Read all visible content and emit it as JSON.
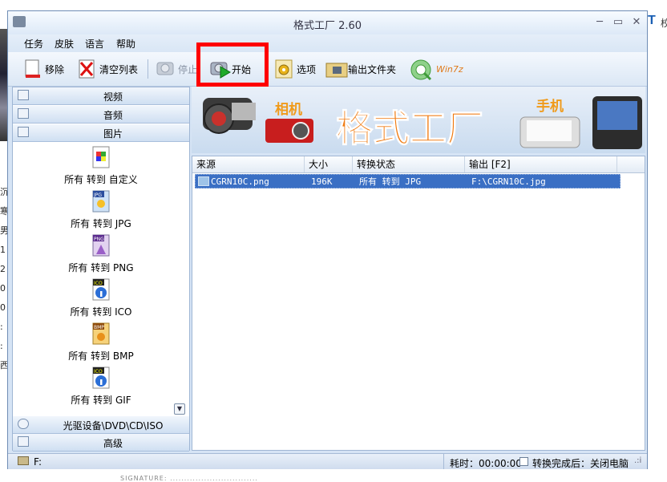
{
  "window": {
    "title": "格式工厂 2.60"
  },
  "window_controls": {
    "minimize": "─",
    "maximize": "▭",
    "close": "✕"
  },
  "menu": [
    "任务",
    "皮肤",
    "语言",
    "帮助"
  ],
  "toolbar": {
    "remove": "移除",
    "clear": "清空列表",
    "stop": "停止",
    "start": "开始",
    "options": "选项",
    "output_folder": "输出文件夹",
    "win7z": "Win7z"
  },
  "sidebar": {
    "video": "视频",
    "audio": "音频",
    "image": "图片",
    "conversions": [
      {
        "label": "所有 转到 自定义",
        "badge": ""
      },
      {
        "label": "所有 转到 JPG",
        "badge": "JPG"
      },
      {
        "label": "所有 转到 PNG",
        "badge": "PNG"
      },
      {
        "label": "所有 转到 ICO",
        "badge": "ICO"
      },
      {
        "label": "所有 转到 BMP",
        "badge": "BMP"
      },
      {
        "label": "所有 转到 GIF",
        "badge": "ICO"
      }
    ],
    "optical": "光驱设备\\DVD\\CD\\ISO",
    "advanced": "高级"
  },
  "banner": {
    "camera": "相机",
    "title": "格式工厂",
    "phone": "手机"
  },
  "list": {
    "headers": [
      "来源",
      "大小",
      "转换状态",
      "输出 [F2]"
    ],
    "rows": [
      {
        "source": "CGRN10C.png",
        "size": "196K",
        "status": "所有 转到 JPG",
        "output": "F:\\CGRN10C.jpg"
      }
    ]
  },
  "status": {
    "drive": "F:",
    "elapsed": "耗时：00:00:00",
    "after_label": "转换完成后：关闭电脑",
    "grip": ".:i"
  },
  "background": {
    "left_chars": [
      "沉",
      "寒",
      "男",
      "1",
      "2",
      "0",
      "0",
      ":",
      ":",
      "西"
    ],
    "right_t": "T",
    "right_c": "校",
    "signature": "SIGNATURE: ..............................."
  },
  "colors": {
    "accent": "#3a6fc4",
    "highlight": "#ff0000",
    "window_bg": "#d6e4f5"
  }
}
